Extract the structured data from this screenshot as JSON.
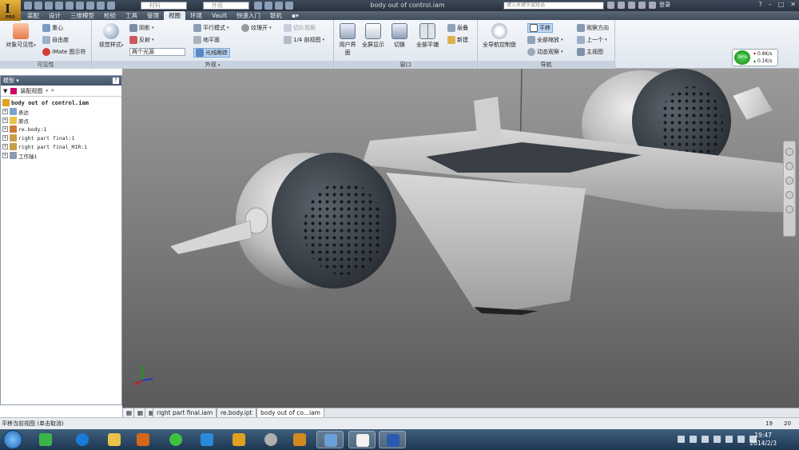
{
  "window": {
    "title": "body out of control.iam",
    "search_placeholder": "键入关键字或短语",
    "signin": "登录"
  },
  "quick_access": {
    "material": "材料",
    "appearance": "外观"
  },
  "menu": [
    "装配",
    "设计",
    "三维模型",
    "检验",
    "工具",
    "管理",
    "视图",
    "环境",
    "Vault",
    "快速入门",
    "联机"
  ],
  "active_menu": "视图",
  "ribbon": {
    "visibility": {
      "label": "可见性",
      "object_visibility": "对象可见性",
      "center_gravity": "重心",
      "dof": "自由度",
      "imate": "iMate 图示符"
    },
    "appearance": {
      "label": "外观",
      "visual_style": "视觉样式",
      "shadows": "阴影",
      "reflection": "反射",
      "lighting": "两个光源",
      "parallel": "平行模式",
      "ground_plane": "地平面",
      "texture": "纹理开",
      "ray_trace": "光线跟踪",
      "slice": "切片观察",
      "quarter": "1/4 剖视图"
    },
    "window": {
      "label": "窗口",
      "user_interface": "用户界面",
      "full_screen": "全屏显示",
      "switch": "切换",
      "tile_all": "全部平铺",
      "cascade": "层叠",
      "new": "新建"
    },
    "navigate": {
      "label": "导航",
      "full_nav_wheel": "全导航控制盘",
      "pan": "平移",
      "zoom_all": "全部缩放",
      "orbit": "动态观察",
      "view_face": "观察方向",
      "previous": "上一个",
      "home": "主视图"
    }
  },
  "performance": {
    "percent": "36%",
    "down": "0.8K/s",
    "up": "0.1K/s"
  },
  "browser": {
    "title": "模型",
    "view": "装配视图",
    "root": "body out of control.iam",
    "nodes": [
      "表达",
      "原点",
      "re.body:1",
      "right part final:1",
      "right part final_MIR:1",
      "工作轴1"
    ]
  },
  "doc_tabs": [
    "right part final.iam",
    "re.body.ipt",
    "body out of co...iam"
  ],
  "status": {
    "text": "平移当前视图 (单击取消)",
    "a": "19",
    "b": "20"
  },
  "clock": {
    "time": "19:47",
    "date": "2014/2/3"
  },
  "colors": {
    "ribbon_bg": "#e8eef6",
    "viewport": "#7a7a7a",
    "taskbar": "#1e3752"
  }
}
